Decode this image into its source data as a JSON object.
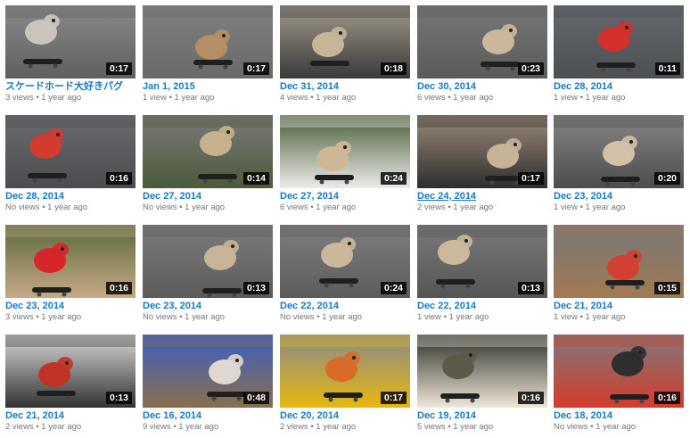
{
  "dot": "•",
  "videos": [
    {
      "title": "スケードホード大好きパグ",
      "duration": "0:17",
      "views": "3 views",
      "age": "1 year ago",
      "scene": "pug-skateboard-curb",
      "colors": [
        "#8a8a8a",
        "#5f5f5f",
        "#c9c5bd"
      ]
    },
    {
      "title": "Jan 1, 2015",
      "duration": "0:17",
      "views": "1 view",
      "age": "1 year ago",
      "scene": "pug-skateboard-far",
      "colors": [
        "#7f7f7f",
        "#6a6a6a",
        "#b58f63"
      ]
    },
    {
      "title": "Dec 31, 2014",
      "duration": "0:18",
      "views": "4 views",
      "age": "1 year ago",
      "scene": "pug-skateboard-street-shadow",
      "colors": [
        "#a29a8c",
        "#3a3a3a",
        "#c7b597"
      ]
    },
    {
      "title": "Dec 30, 2014",
      "duration": "0:23",
      "views": "6 views",
      "age": "1 year ago",
      "scene": "pug-camo-jacket",
      "colors": [
        "#777777",
        "#5a5a5a",
        "#cbb79c"
      ]
    },
    {
      "title": "Dec 28, 2014",
      "duration": "0:11",
      "views": "1 view",
      "age": "1 year ago",
      "scene": "pug-red-jacket-far",
      "colors": [
        "#666a6e",
        "#4c4f52",
        "#d3302c"
      ]
    },
    {
      "title": "Dec 28, 2014",
      "duration": "0:16",
      "views": "No views",
      "age": "1 year ago",
      "scene": "pug-red-jacket",
      "colors": [
        "#6a6c70",
        "#4a4c50",
        "#d33b2f"
      ]
    },
    {
      "title": "Dec 27, 2014",
      "duration": "0:14",
      "views": "No views",
      "age": "1 year ago",
      "scene": "pug-camo-closeup",
      "colors": [
        "#7a7a78",
        "#4d5a3b",
        "#c7b18e"
      ]
    },
    {
      "title": "Dec 27, 2014",
      "duration": "0:24",
      "views": "6 views",
      "age": "1 year ago",
      "scene": "pug-white-shirt-garden",
      "colors": [
        "#4b5d38",
        "#ececec",
        "#cfb796"
      ]
    },
    {
      "title": "Dec 24, 2014",
      "duration": "0:17",
      "views": "2 views",
      "age": "1 year ago",
      "scene": "pug-stripe-orange-road",
      "colors": [
        "#9b8a7b",
        "#2e2e2e",
        "#c7b497"
      ]
    },
    {
      "title": "Dec 23, 2014",
      "duration": "0:20",
      "views": "1 view",
      "age": "1 year ago",
      "scene": "pug-road-hood",
      "colors": [
        "#858585",
        "#4d4d4d",
        "#d2c1a6"
      ]
    },
    {
      "title": "Dec 23, 2014",
      "duration": "0:16",
      "views": "3 views",
      "age": "1 year ago",
      "scene": "pug-red-leash-flowers",
      "colors": [
        "#5a6a3c",
        "#c7a986",
        "#d7252b"
      ]
    },
    {
      "title": "Dec 23, 2014",
      "duration": "0:13",
      "views": "No views",
      "age": "1 year ago",
      "scene": "pug-back-street",
      "colors": [
        "#7c7c7c",
        "#5b5b5b",
        "#c8b496"
      ]
    },
    {
      "title": "Dec 22, 2014",
      "duration": "0:24",
      "views": "No views",
      "age": "1 year ago",
      "scene": "pug-road-mid",
      "colors": [
        "#7f7f7f",
        "#5b5b5b",
        "#cbb89b"
      ]
    },
    {
      "title": "Dec 22, 2014",
      "duration": "0:13",
      "views": "1 view",
      "age": "1 year ago",
      "scene": "pug-road-close",
      "colors": [
        "#7a7a7a",
        "#555555",
        "#ccb89a"
      ]
    },
    {
      "title": "Dec 21, 2014",
      "duration": "0:15",
      "views": "1 view",
      "age": "1 year ago",
      "scene": "pug-reindeer-far",
      "colors": [
        "#777777",
        "#a27a52",
        "#d23f33"
      ]
    },
    {
      "title": "Dec 21, 2014",
      "duration": "0:13",
      "views": "2 views",
      "age": "1 year ago",
      "scene": "pug-reindeer-close",
      "colors": [
        "#d8d8d8",
        "#333333",
        "#c23327"
      ]
    },
    {
      "title": "Dec 16, 2014",
      "duration": "0:48",
      "views": "9 views",
      "age": "1 year ago",
      "scene": "pug-in-helmet",
      "colors": [
        "#3b5fc4",
        "#8a6f4d",
        "#e0d8cf"
      ]
    },
    {
      "title": "Dec 20, 2014",
      "duration": "0:17",
      "views": "2 views",
      "age": "1 year ago",
      "scene": "pug-costume-yellow",
      "colors": [
        "#8a8a8a",
        "#e8b70f",
        "#d86b2a"
      ]
    },
    {
      "title": "Dec 19, 2014",
      "duration": "0:16",
      "views": "5 views",
      "age": "1 year ago",
      "scene": "pug-dark-night",
      "colors": [
        "#2e2f2a",
        "#efe7d8",
        "#5e5a4a"
      ]
    },
    {
      "title": "Dec 18, 2014",
      "duration": "0:16",
      "views": "No views",
      "age": "1 year ago",
      "scene": "pug-red-coat",
      "colors": [
        "#7b7b7b",
        "#d73a2b",
        "#2e2e2e"
      ]
    }
  ],
  "highlighted_index": 8
}
